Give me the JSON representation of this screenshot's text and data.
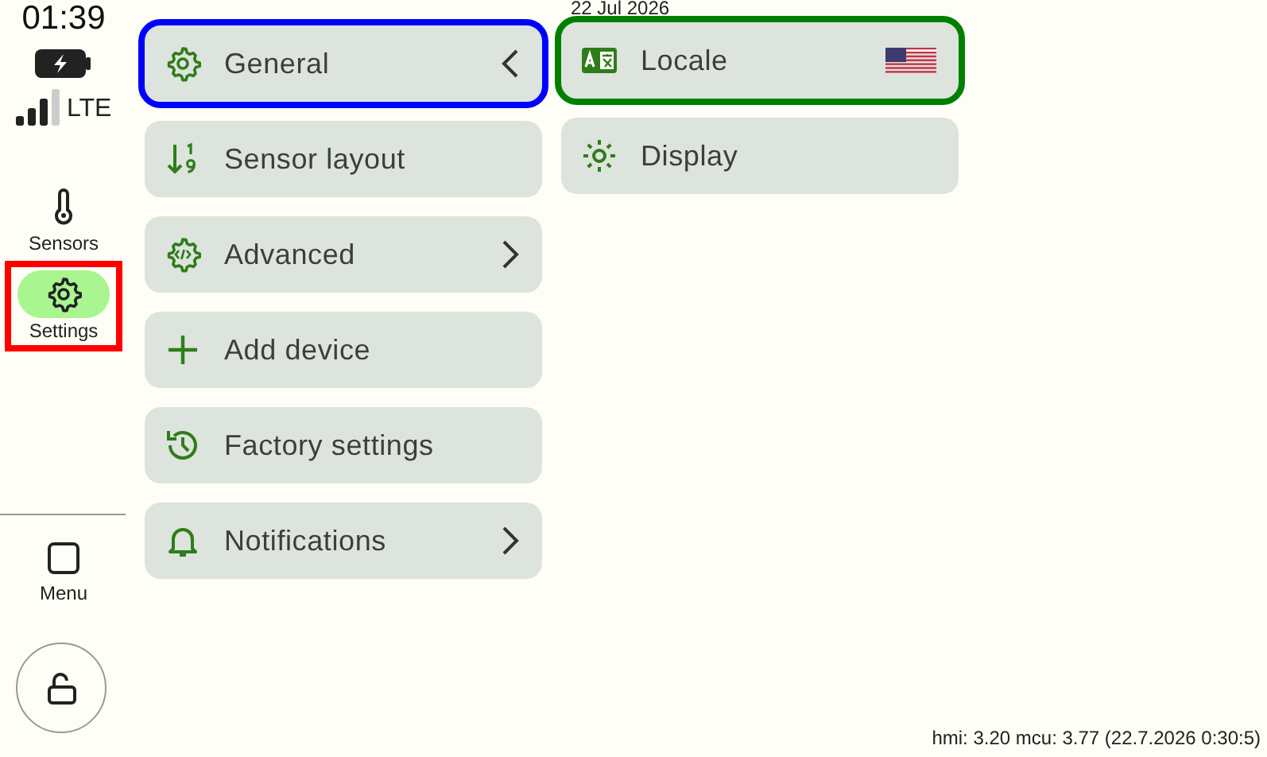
{
  "status": {
    "time": "01:39",
    "charging": true,
    "network": "LTE"
  },
  "date": "22 Jul 2026",
  "nav": [
    {
      "label": "Sensors",
      "selected": false
    },
    {
      "label": "Settings",
      "selected": true
    }
  ],
  "menu_button": {
    "label": "Menu"
  },
  "lock": {
    "locked": false
  },
  "settings_menu": [
    {
      "label": "General",
      "submenu": true,
      "expanded": true,
      "selected": true
    },
    {
      "label": "Sensor layout",
      "submenu": false,
      "selected": false
    },
    {
      "label": "Advanced",
      "submenu": true,
      "expanded": false,
      "selected": false
    },
    {
      "label": "Add device",
      "submenu": false,
      "selected": false
    },
    {
      "label": "Factory settings",
      "submenu": false,
      "selected": false
    },
    {
      "label": "Notifications",
      "submenu": true,
      "expanded": false,
      "selected": false
    }
  ],
  "general_menu": [
    {
      "label": "Locale",
      "flag": true,
      "selected": true
    },
    {
      "label": "Display",
      "flag": false,
      "selected": false
    }
  ],
  "version": "hmi: 3.20 mcu: 3.77 (22.7.2026 0:30:5)"
}
